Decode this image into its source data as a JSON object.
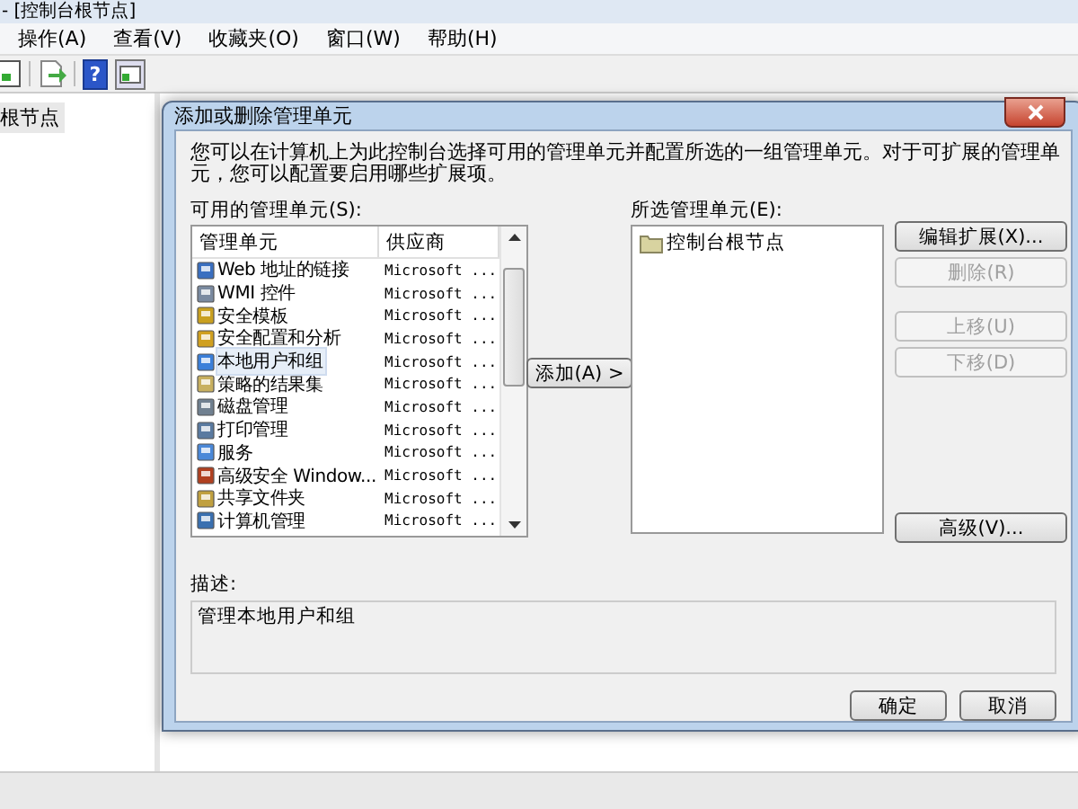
{
  "app": {
    "title": "- [控制台根节点]",
    "menu": [
      "操作(A)",
      "查看(V)",
      "收藏夹(O)",
      "窗口(W)",
      "帮助(H)"
    ],
    "help_glyph": "?",
    "tree": [
      {
        "label": "根节点",
        "selected": true
      }
    ]
  },
  "dialog": {
    "title": "添加或删除管理单元",
    "intro": "您可以在计算机上为此控制台选择可用的管理单元并配置所选的一组管理单元。对于可扩展的管理单元，您可以配置要启用哪些扩展项。",
    "available_label": "可用的管理单元(S):",
    "columns": [
      "管理单元",
      "供应商"
    ],
    "available": [
      {
        "name": "Web 地址的链接",
        "vendor": "Microsoft ...",
        "selected": false
      },
      {
        "name": "WMI 控件",
        "vendor": "Microsoft ...",
        "selected": false
      },
      {
        "name": "安全模板",
        "vendor": "Microsoft ...",
        "selected": false
      },
      {
        "name": "安全配置和分析",
        "vendor": "Microsoft ...",
        "selected": false
      },
      {
        "name": "本地用户和组",
        "vendor": "Microsoft ...",
        "selected": true
      },
      {
        "name": "策略的结果集",
        "vendor": "Microsoft ...",
        "selected": false
      },
      {
        "name": "磁盘管理",
        "vendor": "Microsoft ...",
        "selected": false
      },
      {
        "name": "打印管理",
        "vendor": "Microsoft ...",
        "selected": false
      },
      {
        "name": "服务",
        "vendor": "Microsoft ...",
        "selected": false
      },
      {
        "name": "高级安全 Window...",
        "vendor": "Microsoft ...",
        "selected": false
      },
      {
        "name": "共享文件夹",
        "vendor": "Microsoft ...",
        "selected": false
      },
      {
        "name": "计算机管理",
        "vendor": "Microsoft ...",
        "selected": false
      }
    ],
    "add_button": "添加(A) >",
    "selected_label": "所选管理单元(E):",
    "selected_items": [
      {
        "label": "控制台根节点",
        "selected": false
      }
    ],
    "side_buttons": [
      {
        "label": "编辑扩展(X)...",
        "disabled": false
      },
      {
        "label": "删除(R)",
        "disabled": true
      },
      {
        "label": "上移(U)",
        "disabled": true
      },
      {
        "label": "下移(D)",
        "disabled": true
      },
      {
        "label": "高级(V)...",
        "disabled": false
      }
    ],
    "description_label": "描述:",
    "description": "管理本地用户和组",
    "buttons": [
      "确定",
      "取消"
    ]
  }
}
